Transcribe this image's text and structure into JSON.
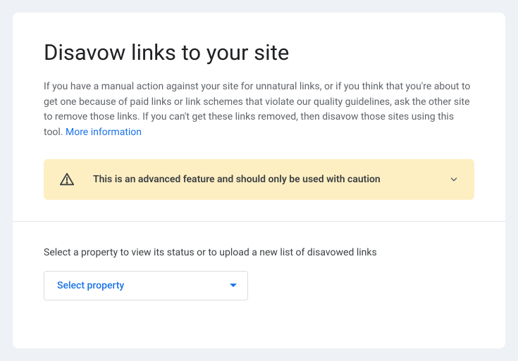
{
  "title": "Disavow links to your site",
  "description": "If you have a manual action against your site for unnatural links, or if you think that you're about to get one because of paid links or link schemes that violate our quality guidelines, ask the other site to remove those links. If you can't get these links removed, then disavow those sites using this tool. ",
  "moreInfoLabel": "More information",
  "warning": {
    "text": "This is an advanced feature and should only be used with caution"
  },
  "selectSection": {
    "label": "Select a property to view its status or to upload a new list of disavowed links",
    "dropdownText": "Select property"
  }
}
